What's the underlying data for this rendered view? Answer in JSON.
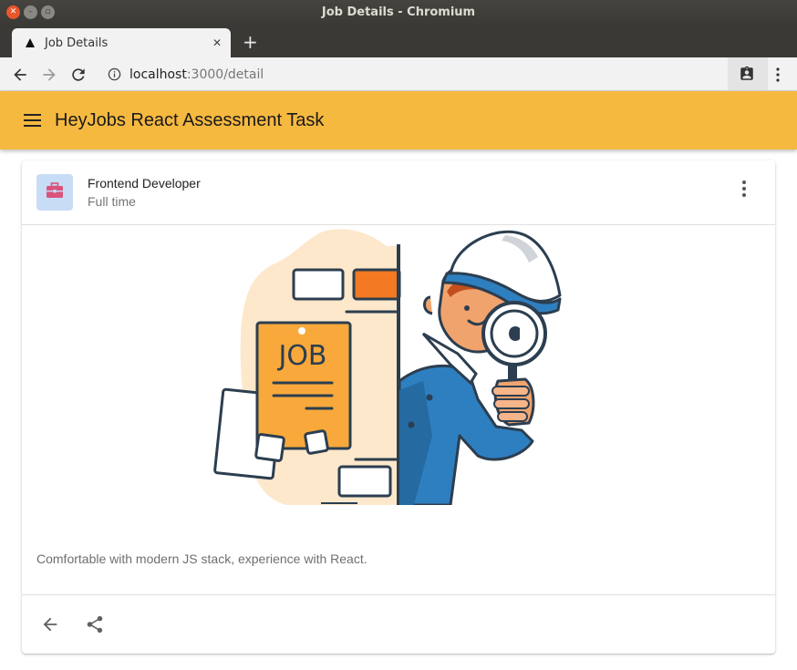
{
  "window": {
    "title": "Job Details - Chromium"
  },
  "tab": {
    "title": "Job Details",
    "close": "✕",
    "new_tab": "+"
  },
  "address": {
    "host": "localhost",
    "path": ":3000/detail"
  },
  "appbar": {
    "title": "HeyJobs React Assessment Task"
  },
  "job": {
    "title": "Frontend Developer",
    "type": "Full time",
    "illustration_text": "JOB",
    "description": "Comfortable with modern JS stack, experience with React."
  },
  "colors": {
    "appbar": "#f6b940",
    "avatar_bg": "#c8dcf6",
    "avatar_icon": "#d9547c"
  },
  "icons": {
    "menu": "menu-icon",
    "more": "more-vert-icon",
    "back": "arrow-back-icon",
    "share": "share-icon",
    "avatar": "briefcase-icon"
  }
}
